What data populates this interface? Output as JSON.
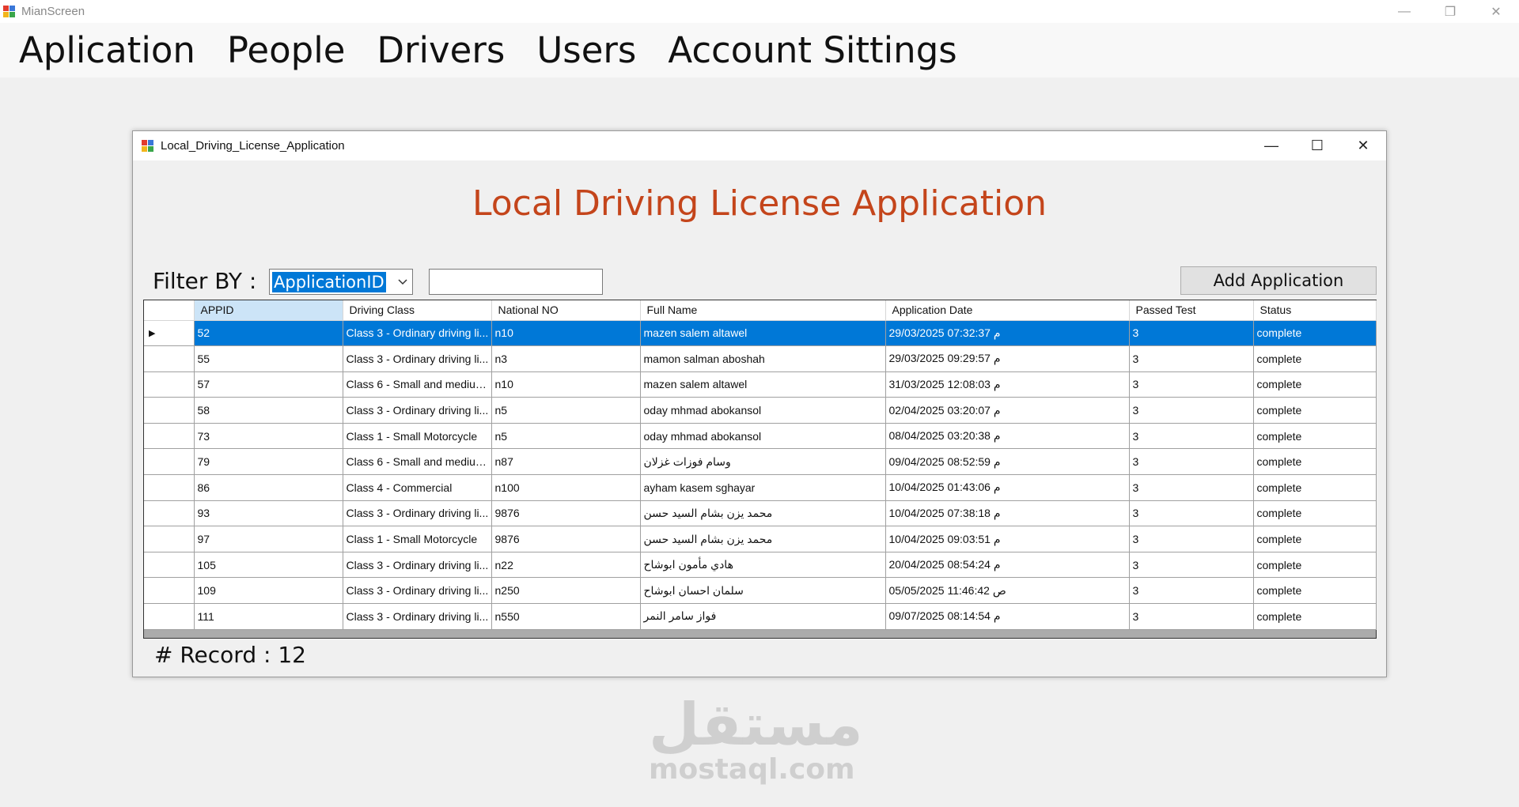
{
  "main_window": {
    "title": "MianScreen",
    "controls": {
      "minimize": "—",
      "restore": "❐",
      "close": "✕"
    }
  },
  "menu": {
    "items": [
      "Aplication",
      "People",
      "Drivers",
      "Users",
      "Account Sittings"
    ]
  },
  "watermark": {
    "arabic": "مستقل",
    "latin": "mostaql.com"
  },
  "child_window": {
    "title": "Local_Driving_License_Application",
    "controls": {
      "minimize": "—",
      "maximize": "☐",
      "close": "✕"
    }
  },
  "form": {
    "title": "Local Driving License Application",
    "filter_label": "Filter BY :",
    "filter_selected": "ApplicationID",
    "filter_text": "",
    "add_button": "Add Application",
    "record_label": "# Record :",
    "record_count": "12"
  },
  "grid": {
    "columns": [
      "APPID",
      "Driving Class",
      "National NO",
      "Full Name",
      "Application Date",
      "Passed Test",
      "Status"
    ],
    "selected_row": 0,
    "rows": [
      [
        "52",
        "Class 3 - Ordinary driving li...",
        "n10",
        "mazen salem altawel",
        "29/03/2025 07:32:37 م",
        "3",
        "complete"
      ],
      [
        "55",
        "Class 3 - Ordinary driving li...",
        "n3",
        "mamon salman   aboshah",
        "29/03/2025 09:29:57 م",
        "3",
        "complete"
      ],
      [
        "57",
        "Class 6 - Small and medium...",
        "n10",
        "mazen salem altawel",
        "31/03/2025 12:08:03 م",
        "3",
        "complete"
      ],
      [
        "58",
        "Class 3 - Ordinary driving li...",
        "n5",
        "oday mhmad abokansol",
        "02/04/2025 03:20:07 م",
        "3",
        "complete"
      ],
      [
        "73",
        "Class 1 - Small Motorcycle",
        "n5",
        "oday mhmad abokansol",
        "08/04/2025 03:20:38 م",
        "3",
        "complete"
      ],
      [
        "79",
        "Class 6 - Small and medium...",
        "n87",
        "وسام فوزات غزلان",
        "09/04/2025 08:52:59 م",
        "3",
        "complete"
      ],
      [
        "86",
        "Class 4 - Commercial",
        "n100",
        "ayham kasem sghayar",
        "10/04/2025 01:43:06 م",
        "3",
        "complete"
      ],
      [
        "93",
        "Class 3 - Ordinary driving li...",
        "9876",
        "محمد يزن بشام السيد حسن",
        "10/04/2025 07:38:18 م",
        "3",
        "complete"
      ],
      [
        "97",
        "Class 1 - Small Motorcycle",
        "9876",
        "محمد يزن بشام السيد حسن",
        "10/04/2025 09:03:51 م",
        "3",
        "complete"
      ],
      [
        "105",
        "Class 3 - Ordinary driving li...",
        "n22",
        "هادي مأمون ابوشاح",
        "20/04/2025 08:54:24 م",
        "3",
        "complete"
      ],
      [
        "109",
        "Class 3 - Ordinary driving li...",
        "n250",
        "سلمان احسان ابوشاح",
        "05/05/2025 11:46:42 ص",
        "3",
        "complete"
      ],
      [
        "111",
        "Class 3 - Ordinary driving li...",
        "n550",
        "فواز سامر النمر",
        "09/07/2025 08:14:54 م",
        "3",
        "complete"
      ]
    ]
  },
  "colors": {
    "title_orange": "#c4451b",
    "selection_blue": "#0078d7",
    "sorted_header": "#cce4f7"
  }
}
